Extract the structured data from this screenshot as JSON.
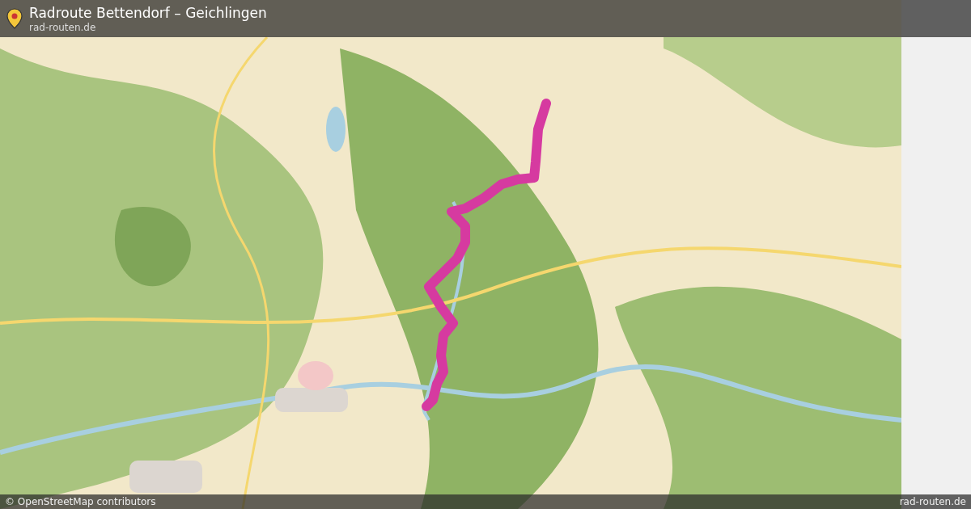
{
  "header": {
    "title": "Radroute Bettendorf – Geichlingen",
    "site": "rad-routen.de"
  },
  "footer": {
    "attribution": "© OpenStreetMap contributors",
    "site": "rad-routen.de"
  }
}
